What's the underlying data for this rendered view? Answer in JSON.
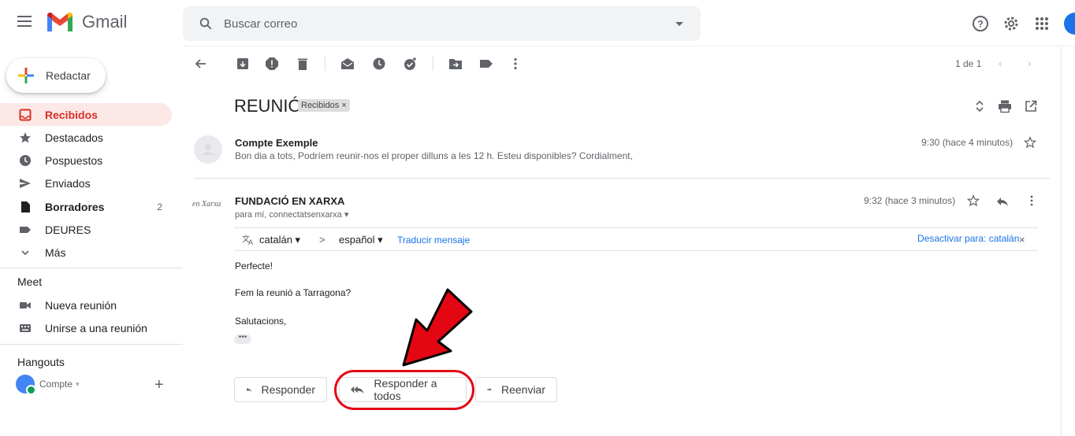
{
  "app": {
    "name": "Gmail"
  },
  "search": {
    "placeholder": "Buscar correo"
  },
  "sidebar": {
    "compose_label": "Redactar",
    "items": [
      {
        "label": "Recibidos",
        "icon": "inbox-icon",
        "active": true,
        "count": ""
      },
      {
        "label": "Destacados",
        "icon": "star-icon",
        "count": ""
      },
      {
        "label": "Pospuestos",
        "icon": "clock-icon",
        "count": ""
      },
      {
        "label": "Enviados",
        "icon": "send-icon",
        "count": ""
      },
      {
        "label": "Borradores",
        "icon": "draft-icon",
        "count": "2",
        "bold": true
      },
      {
        "label": "DEURES",
        "icon": "label-icon",
        "count": ""
      },
      {
        "label": "Más",
        "icon": "chevron-down-icon",
        "count": ""
      }
    ],
    "meet": {
      "title": "Meet",
      "new_meeting": "Nueva reunión",
      "join_meeting": "Unirse a una reunión"
    },
    "hangouts": {
      "title": "Hangouts",
      "user": "Compte"
    }
  },
  "toolbar": {
    "pager": "1 de 1"
  },
  "thread": {
    "subject": "REUNIÓ",
    "label_chip": "Recibidos ×",
    "messages": [
      {
        "sender": "Compte Exemple",
        "snippet": "Bon dia a tots, Podríem reunir-nos el proper dilluns a les 12 h. Esteu disponibles? Cordialment,",
        "time": "9:30 (hace 4 minutos)"
      },
      {
        "sender": "FUNDACIÓ EN XARXA",
        "logo_text": "en Xarxa",
        "recipients": "para mí, connectatsenxarxa",
        "time": "9:32 (hace 3 minutos)",
        "translate": {
          "from": "catalán",
          "arrow": ">",
          "to": "español",
          "action": "Traducir mensaje",
          "disable": "Desactivar para: catalán"
        },
        "body": [
          "Perfecte!",
          "Fem la reunió a Tarragona?",
          "Salutacions,"
        ],
        "ellipsis": "•••"
      }
    ]
  },
  "actions": {
    "reply": "Responder",
    "reply_all": "Responder a todos",
    "forward": "Reenviar"
  },
  "colors": {
    "active_nav_bg": "#fce8e6",
    "active_nav_text": "#d93025",
    "highlight": "#e30613",
    "link": "#1a73e8"
  }
}
